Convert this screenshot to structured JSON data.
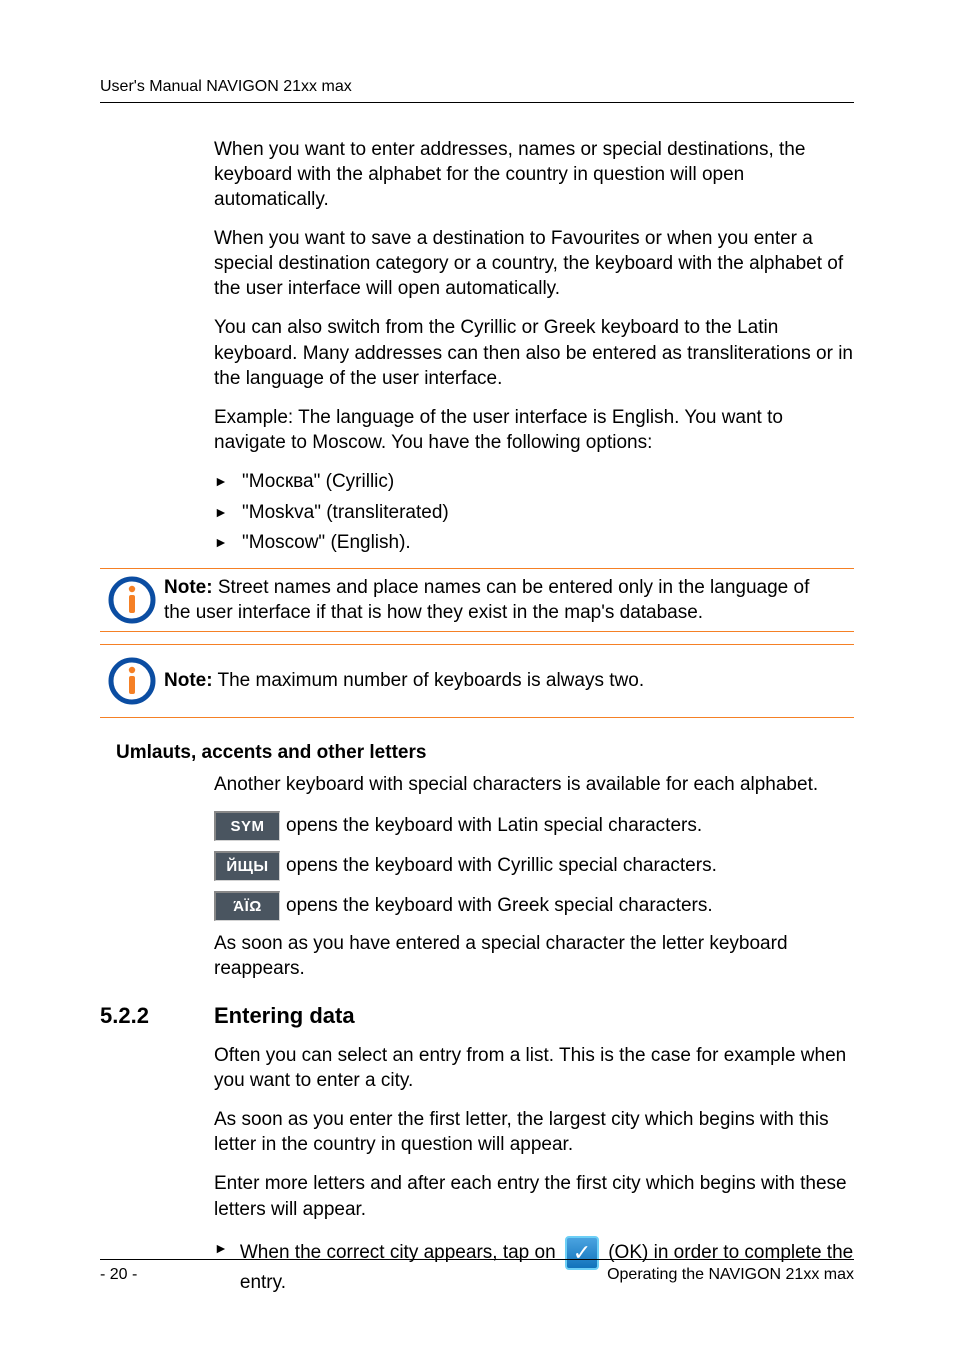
{
  "header": {
    "title": "User's Manual NAVIGON 21xx max"
  },
  "body": {
    "p1": "When you want to enter addresses, names or special destinations, the keyboard with the alphabet for the country in question will open automatically.",
    "p2": "When you want to save a destination to Favourites or when you enter a special destination category or a country, the keyboard with the alphabet of the user interface will open automatically.",
    "p3": "You can also switch from the Cyrillic or Greek keyboard to the Latin keyboard. Many addresses can then also be entered as transliterations or in the language of the user interface.",
    "p4": "Example: The language of the user interface is English. You want to navigate to Moscow. You have the following options:",
    "bullets": [
      "\"Москва\" (Cyrillic)",
      "\"Moskva\" (transliterated)",
      "\"Moscow\" (English)."
    ]
  },
  "notes": {
    "n1_bold": "Note:",
    "n1_text": " Street names and place names can be entered only in the language of the user interface if that is how they exist in the map's database.",
    "n2_bold": "Note:",
    "n2_text": " The maximum number of keyboards is always two."
  },
  "umlauts": {
    "heading": "Umlauts, accents and other letters",
    "intro": "Another keyboard with special characters is available for each alphabet.",
    "badges": {
      "sym": "SYM",
      "cyr": "ЙЩЫ",
      "grk": "ΆΪΩ"
    },
    "lines": {
      "sym": "opens the keyboard with Latin special characters.",
      "cyr": "opens the keyboard with Cyrillic special characters.",
      "grk": "opens the keyboard with Greek special characters."
    },
    "outro": "As soon as you have entered a special character the letter keyboard reappears."
  },
  "section": {
    "num": "5.2.2",
    "title": "Entering data",
    "p1": "Often you can select an entry from a list. This is the case for example when you want to enter a city.",
    "p2": "As soon as you enter the first letter, the largest city which begins with this letter in the country in question will appear.",
    "p3": "Enter more letters and after each entry the first city which begins with these letters will appear.",
    "b1_pre": "When the correct city appears, tap on",
    "b1_ok_label": "OK",
    "b1_paren_open": "(",
    "b1_paren_close": ")",
    "b1_post": " in order to complete the entry."
  },
  "footer": {
    "page": "- 20 -",
    "right": "Operating the NAVIGON 21xx max"
  }
}
